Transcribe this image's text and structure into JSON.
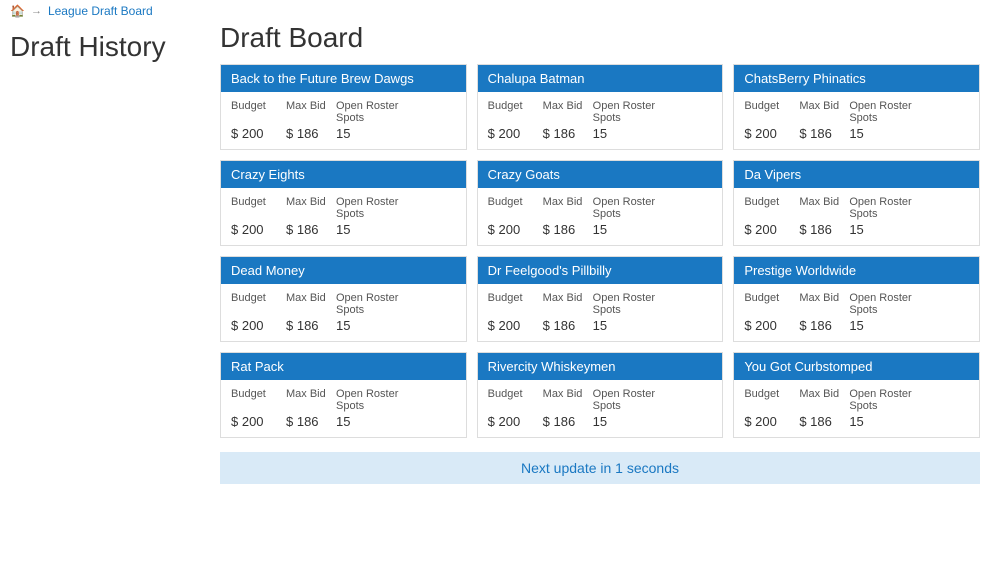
{
  "topbar": {
    "home_label": "🏠",
    "arrow": "→",
    "breadcrumb": "League Draft Board"
  },
  "sidebar": {
    "title": "Draft History"
  },
  "main": {
    "title": "Draft Board",
    "teams": [
      {
        "name": "Back to the Future Brew Dawgs",
        "budget": "$ 200",
        "max_bid": "$ 186",
        "open_roster": "15"
      },
      {
        "name": "Chalupa Batman",
        "budget": "$ 200",
        "max_bid": "$ 186",
        "open_roster": "15"
      },
      {
        "name": "ChatsBerry Phinatics",
        "budget": "$ 200",
        "max_bid": "$ 186",
        "open_roster": "15"
      },
      {
        "name": "Crazy Eights",
        "budget": "$ 200",
        "max_bid": "$ 186",
        "open_roster": "15"
      },
      {
        "name": "Crazy Goats",
        "budget": "$ 200",
        "max_bid": "$ 186",
        "open_roster": "15"
      },
      {
        "name": "Da Vipers",
        "budget": "$ 200",
        "max_bid": "$ 186",
        "open_roster": "15"
      },
      {
        "name": "Dead Money",
        "budget": "$ 200",
        "max_bid": "$ 186",
        "open_roster": "15"
      },
      {
        "name": "Dr Feelgood's Pillbilly",
        "budget": "$ 200",
        "max_bid": "$ 186",
        "open_roster": "15"
      },
      {
        "name": "Prestige Worldwide",
        "budget": "$ 200",
        "max_bid": "$ 186",
        "open_roster": "15"
      },
      {
        "name": "Rat Pack",
        "budget": "$ 200",
        "max_bid": "$ 186",
        "open_roster": "15"
      },
      {
        "name": "Rivercity Whiskeymen",
        "budget": "$ 200",
        "max_bid": "$ 186",
        "open_roster": "15"
      },
      {
        "name": "You Got Curbstomped",
        "budget": "$ 200",
        "max_bid": "$ 186",
        "open_roster": "15"
      }
    ],
    "col_labels": {
      "budget": "Budget",
      "max_bid": "Max Bid",
      "open_roster": "Open Roster Spots"
    },
    "status": "Next update in 1 seconds"
  }
}
